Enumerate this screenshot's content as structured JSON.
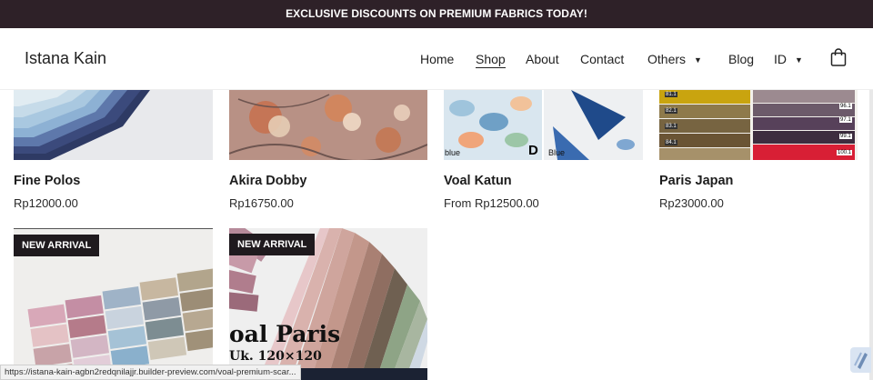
{
  "promo": {
    "text": "EXCLUSIVE DISCOUNTS ON PREMIUM FABRICS TODAY!"
  },
  "header": {
    "brand": "Istana Kain",
    "nav": [
      "Home",
      "Shop",
      "About",
      "Contact",
      "Others",
      "Blog",
      "ID"
    ],
    "active": "Shop"
  },
  "products": [
    {
      "name": "Fine Polos",
      "price": "Rp12000.00"
    },
    {
      "name": "Akira Dobby",
      "price": "Rp16750.00"
    },
    {
      "name": "Voal Katun",
      "price": "From Rp12500.00",
      "img_labels": [
        "blue",
        "D",
        "Blue"
      ]
    },
    {
      "name": "Paris Japan",
      "price": "Rp23000.00",
      "img_labels": [
        "81.1",
        "82.1",
        "83.1",
        "84.1",
        "96.1",
        "97.1",
        "99.1",
        "100.1"
      ]
    }
  ],
  "arrivals": [
    {
      "badge": "NEW ARRIVAL"
    },
    {
      "badge": "NEW ARRIVAL",
      "img_text": "oal Paris",
      "img_subtext": "Uk. 120×120"
    }
  ],
  "status_url": "https://istana-kain-agbn2redqnilajjr.builder-preview.com/voal-premium-scar...",
  "colors": {
    "promo_bg": "#2e2128",
    "badge_bg": "#1f1a1e"
  }
}
